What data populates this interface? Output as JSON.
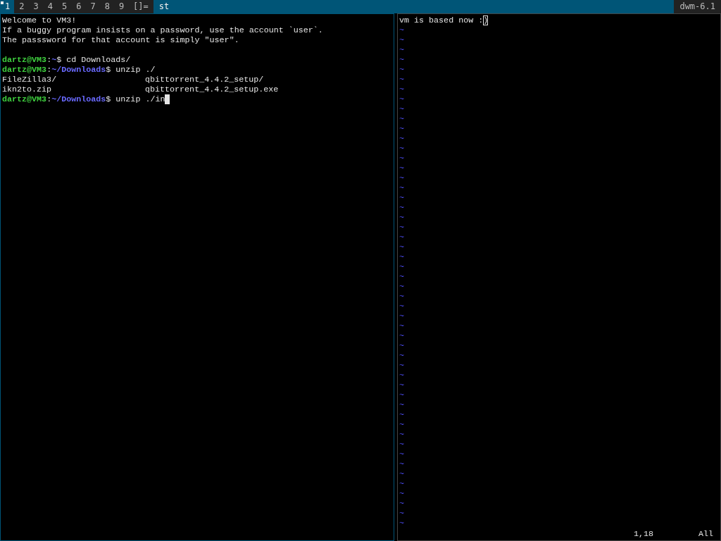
{
  "bar": {
    "tags": [
      {
        "label": "1",
        "selected": true,
        "occupied": true
      },
      {
        "label": "2",
        "selected": false,
        "occupied": false
      },
      {
        "label": "3",
        "selected": false,
        "occupied": false
      },
      {
        "label": "4",
        "selected": false,
        "occupied": false
      },
      {
        "label": "5",
        "selected": false,
        "occupied": false
      },
      {
        "label": "6",
        "selected": false,
        "occupied": false
      },
      {
        "label": "7",
        "selected": false,
        "occupied": false
      },
      {
        "label": "8",
        "selected": false,
        "occupied": false
      },
      {
        "label": "9",
        "selected": false,
        "occupied": false
      }
    ],
    "layout": "[]=",
    "title": "st",
    "status": "dwm-6.1"
  },
  "terminal": {
    "lines": [
      {
        "kind": "text",
        "text": "Welcome to VM3!"
      },
      {
        "kind": "text",
        "text": "If a buggy program insists on a password, use the account `user`."
      },
      {
        "kind": "text",
        "text": "The passsword for that account is simply \"user\"."
      },
      {
        "kind": "blank"
      },
      {
        "kind": "prompt",
        "user": "dartz@VM3",
        "sep": ":",
        "path": "~",
        "command": "$ cd Downloads/",
        "cursor": false
      },
      {
        "kind": "prompt",
        "user": "dartz@VM3",
        "sep": ":",
        "path": "~/Downloads",
        "command": "$ unzip ./",
        "cursor": false
      },
      {
        "kind": "columns",
        "cells": [
          "FileZilla3/",
          "qbittorrent_4.4.2_setup/"
        ]
      },
      {
        "kind": "columns",
        "cells": [
          "ikn2to.zip",
          "qbittorrent_4.4.2_setup.exe"
        ]
      },
      {
        "kind": "prompt",
        "user": "dartz@VM3",
        "sep": ":",
        "path": "~/Downloads",
        "command": "$ unzip ./in",
        "cursor": true
      }
    ]
  },
  "editor": {
    "text": "vm is based now :",
    "cursor_char": ")",
    "tildes": [
      "~",
      "~",
      "~",
      "~",
      "~",
      "~",
      "~",
      "~",
      "~",
      "~",
      "~",
      "~",
      "~",
      "~",
      "~",
      "~",
      "~",
      "~",
      "~",
      "~",
      "~",
      "~",
      "~",
      "~",
      "~",
      "~",
      "~",
      "~",
      "~",
      "~",
      "~",
      "~",
      "~",
      "~",
      "~",
      "~",
      "~",
      "~",
      "~",
      "~",
      "~",
      "~",
      "~",
      "~",
      "~",
      "~",
      "~",
      "~",
      "~",
      "~",
      "~"
    ],
    "ruler": "1,18",
    "position": "All"
  }
}
